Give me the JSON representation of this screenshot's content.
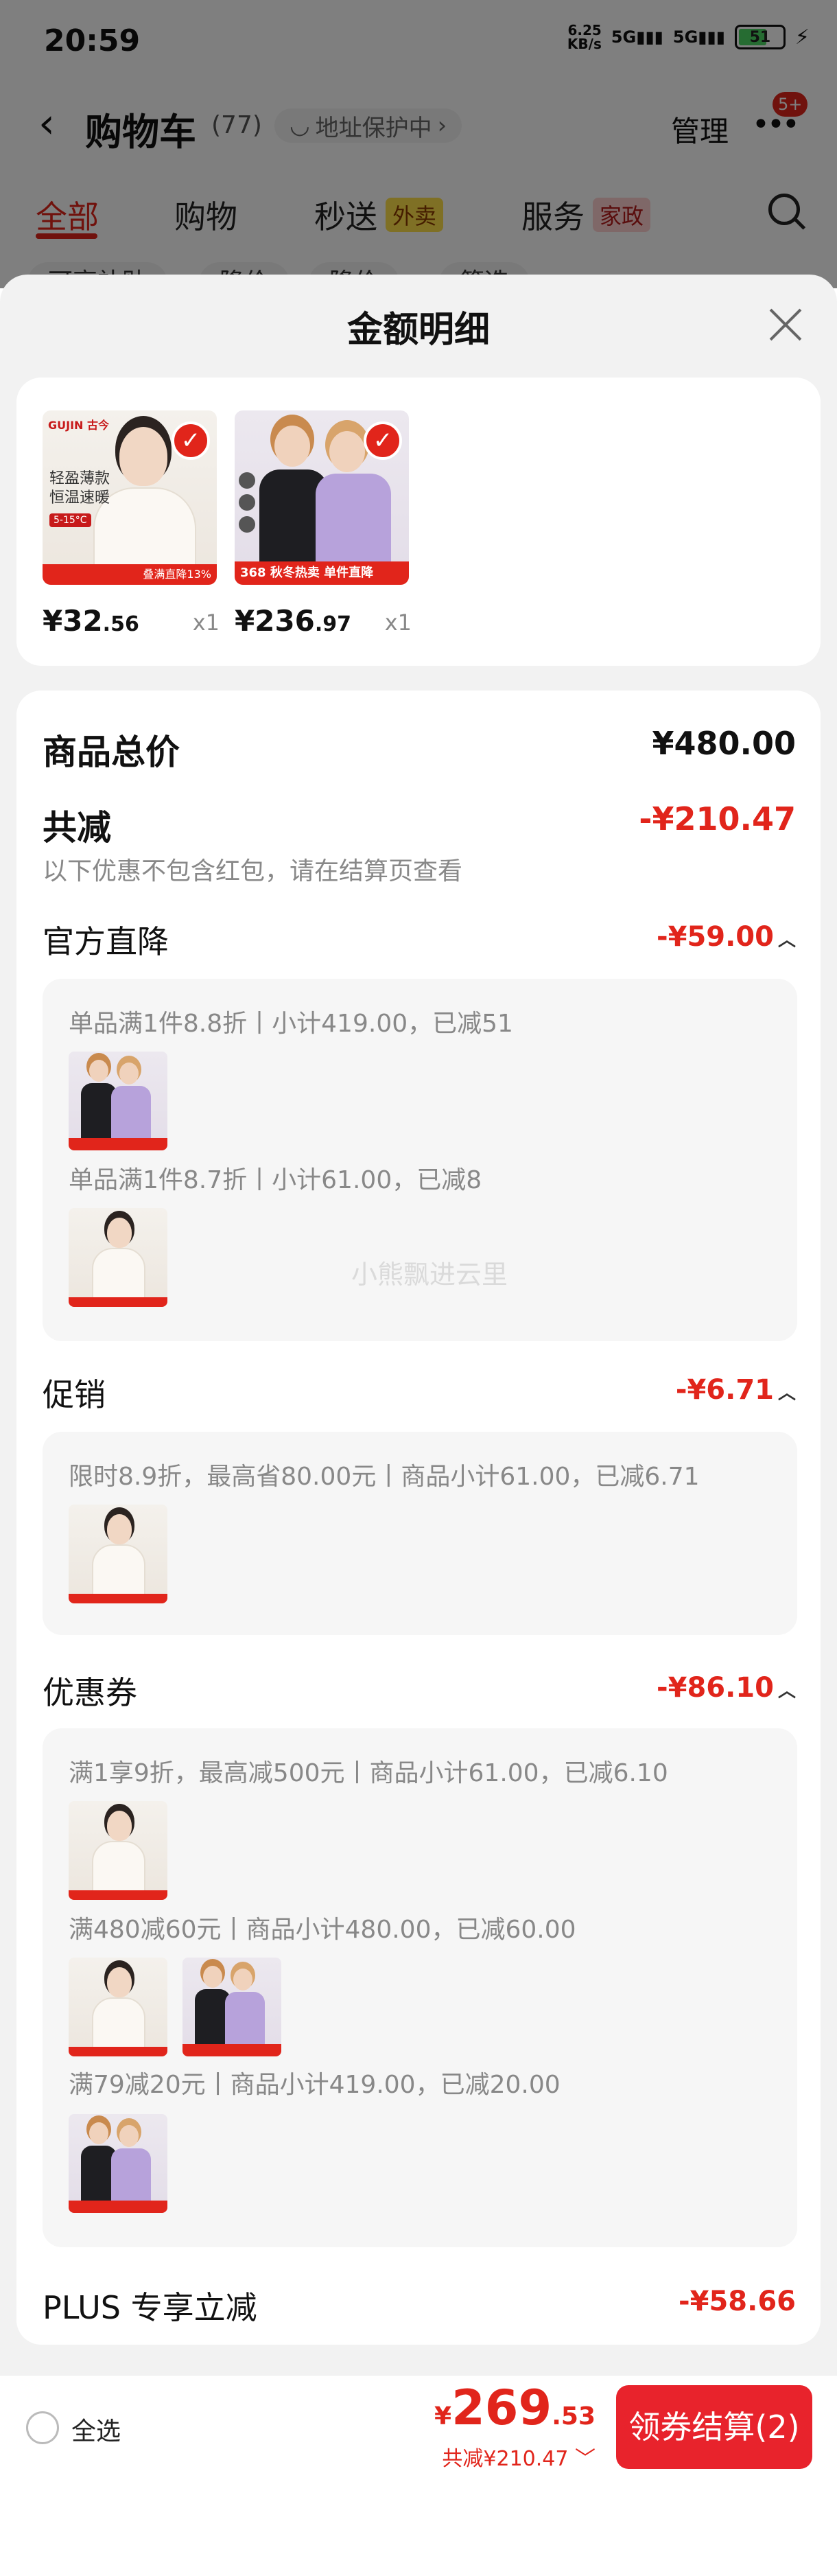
{
  "status_bar": {
    "time": "20:59",
    "net_speed": "6.25",
    "net_unit": "KB/s",
    "sig1": "5G",
    "sig2": "5G",
    "battery": "51"
  },
  "header": {
    "title": "购物车",
    "count": "(77)",
    "addr_protect": "地址保护中",
    "manage": "管理",
    "badge": "5+"
  },
  "tabs": [
    {
      "label": "全部"
    },
    {
      "label": "购物"
    },
    {
      "label": "秒送",
      "tag": "外卖"
    },
    {
      "label": "服务",
      "tag": "家政"
    }
  ],
  "filters": [
    "可享补贴",
    "降价",
    "降价",
    "筛选"
  ],
  "sheet": {
    "title": "金额明细"
  },
  "products": [
    {
      "price_int": "¥32",
      "price_dec": ".56",
      "qty": "x1",
      "brand": "GUJIN 古今",
      "slogan": "轻盈薄款 恒温速暖",
      "temp": "5-15°C",
      "stripe": "叠满直降13%"
    },
    {
      "price_int": "¥236",
      "price_dec": ".97",
      "qty": "x1",
      "price_tag": "368  秋冬热卖 单件直降"
    }
  ],
  "summary": {
    "total_label": "商品总价",
    "total_value": "¥480.00",
    "reduce_label": "共减",
    "reduce_value": "-¥210.47",
    "reduce_note": "以下优惠不包含红包，请在结算页查看"
  },
  "official": {
    "label": "官方直降",
    "value": "-¥59.00",
    "rules": [
      "单品满1件8.8折丨小计419.00，已减51",
      "单品满1件8.7折丨小计61.00，已减8"
    ]
  },
  "promo": {
    "label": "促销",
    "value": "-¥6.71",
    "rules": [
      "限时8.9折，最高省80.00元丨商品小计61.00，已减6.71"
    ]
  },
  "coupon": {
    "label": "优惠券",
    "value": "-¥86.10",
    "rules": [
      "满1享9折，最高减500元丨商品小计61.00，已减6.10",
      "满480减60元丨商品小计480.00，已减60.00",
      "满79减20元丨商品小计419.00，已减20.00"
    ]
  },
  "plus": {
    "label": "PLUS 专享立减",
    "value": "-¥58.66"
  },
  "watermark": "小熊飘进云里",
  "bottom": {
    "select_all": "全选",
    "currency": "¥",
    "total_int": "269",
    "total_dec": ".53",
    "discount": "共减¥210.47",
    "checkout": "领券结算(2)"
  },
  "colors": {
    "accent": "#e1251b",
    "sheet_bg": "#f2f2f2"
  }
}
